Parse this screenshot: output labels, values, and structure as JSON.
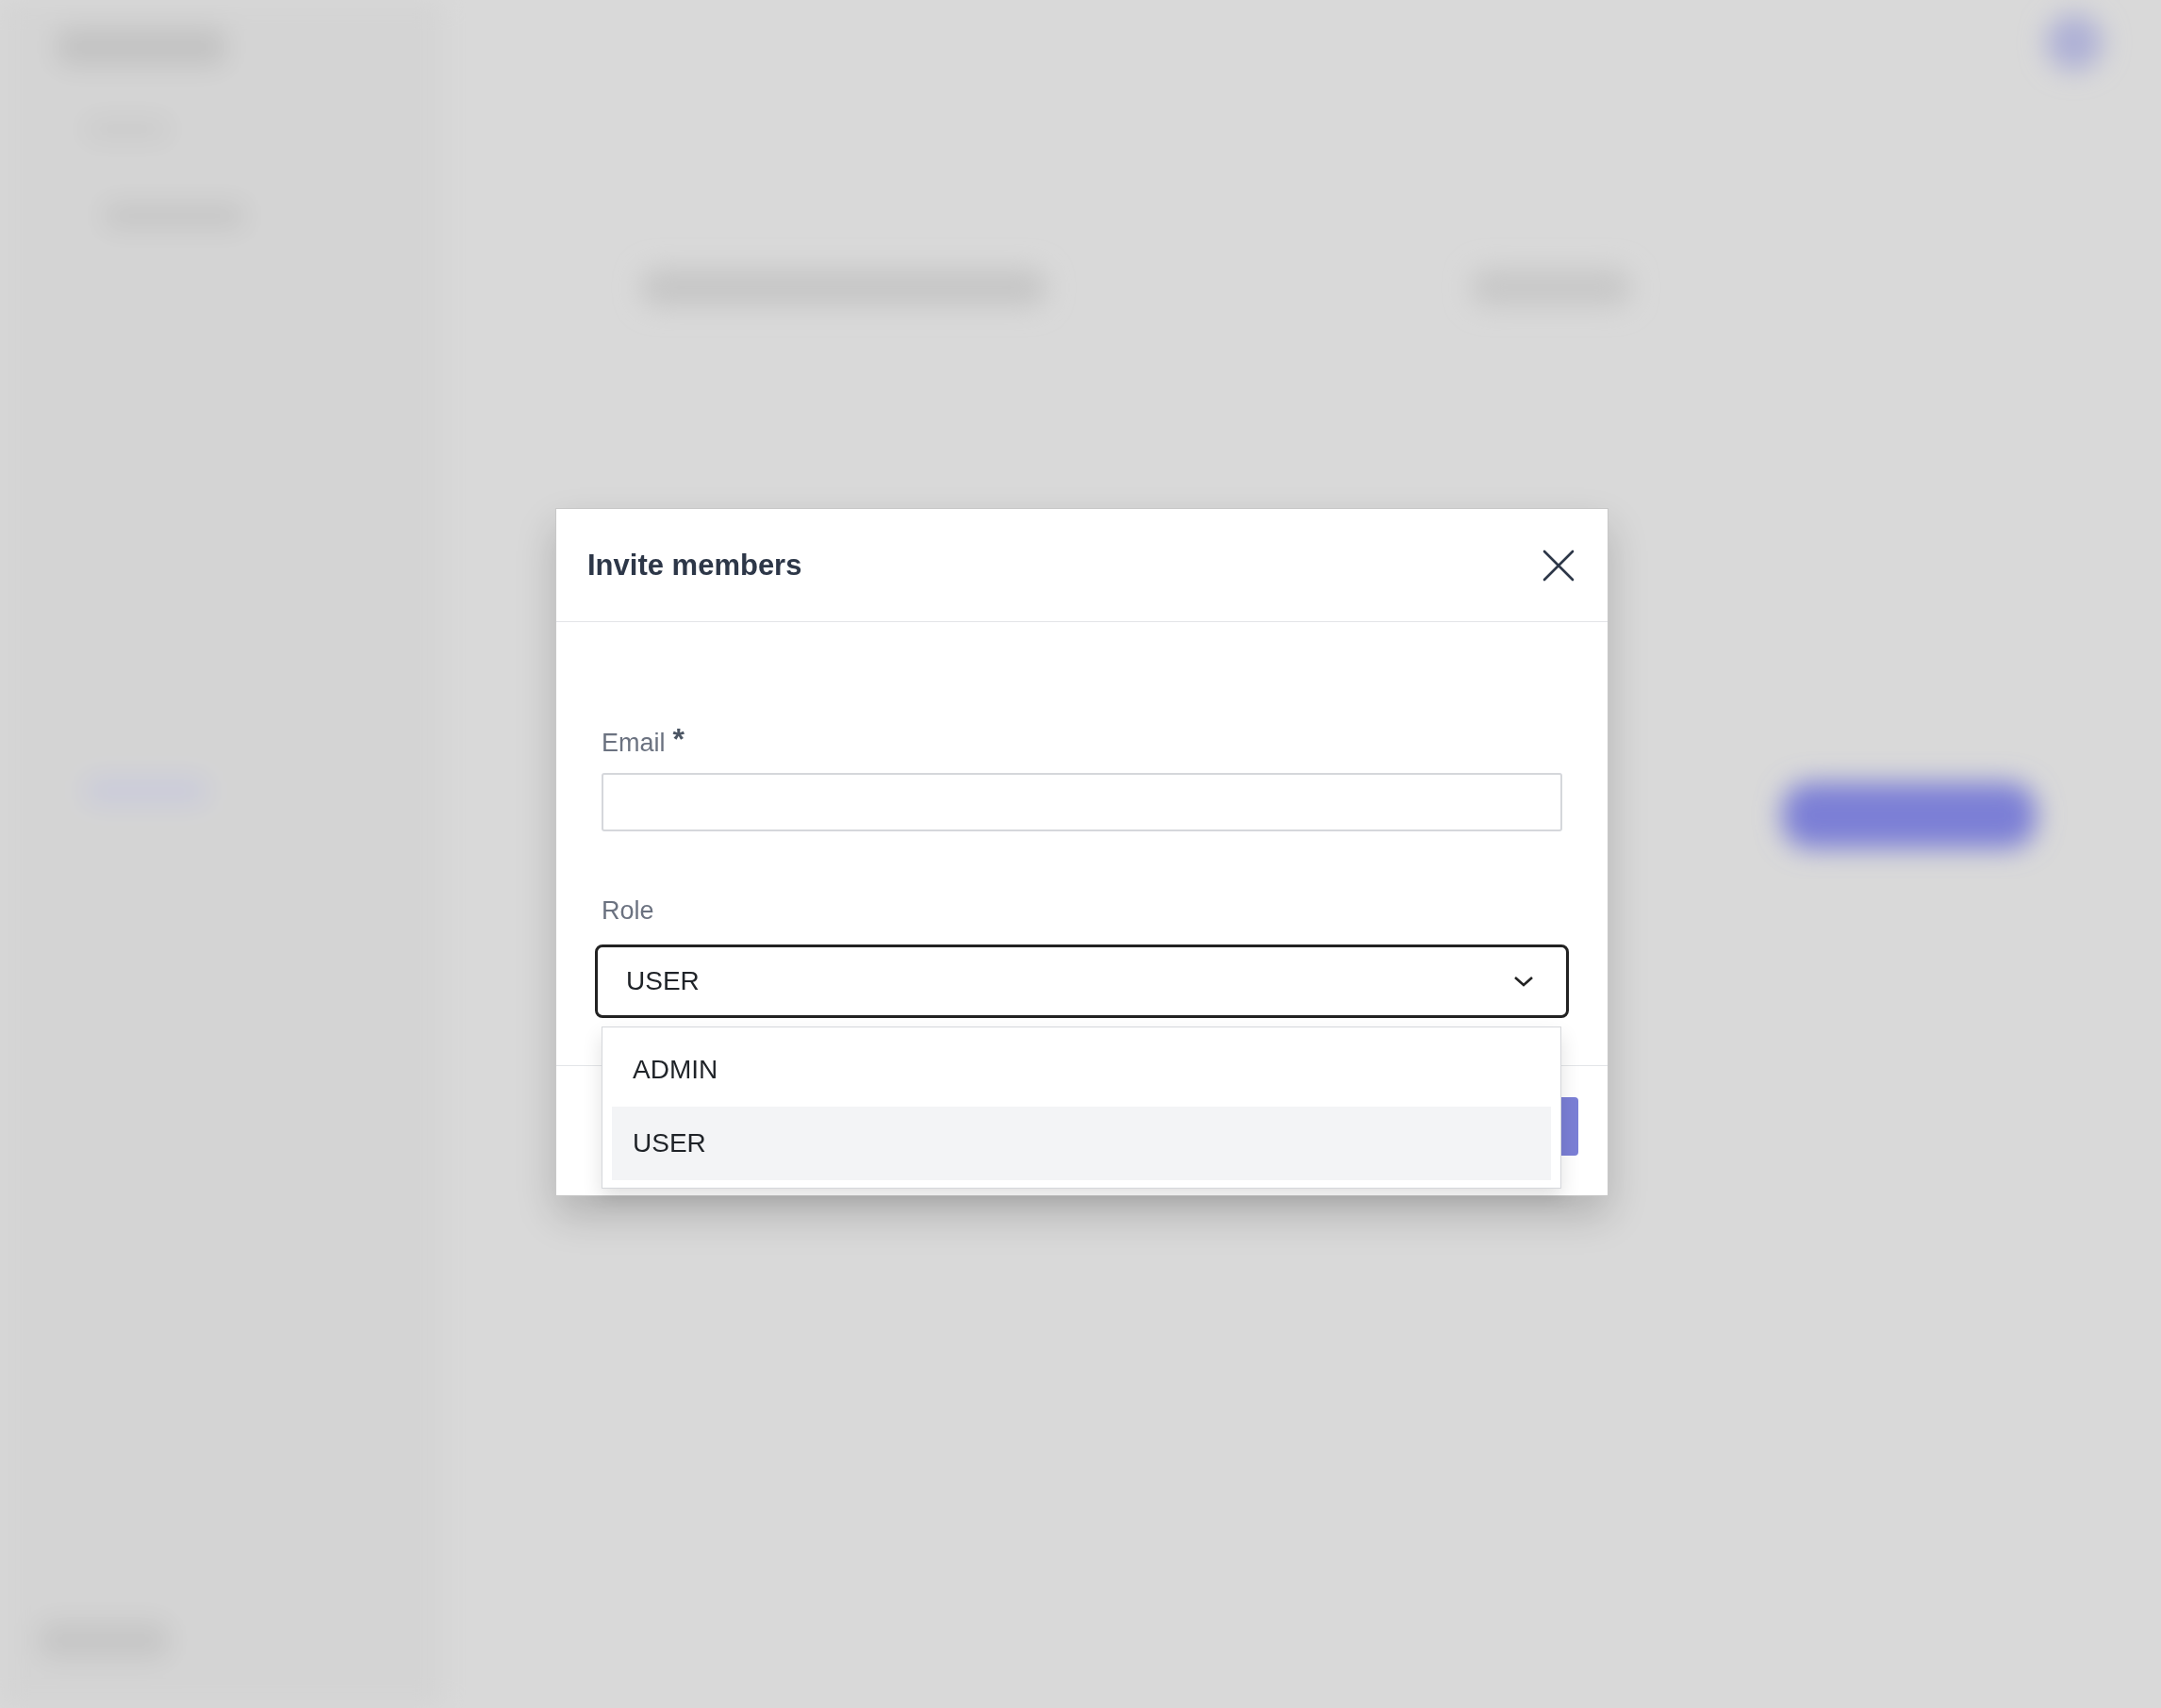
{
  "dialog": {
    "title": "Invite members",
    "fields": [
      {
        "kind": "text",
        "label": "Email",
        "required_mark": "*"
      },
      {
        "kind": "select",
        "label": "Role",
        "value": "USER",
        "expanded": true,
        "options": [
          {
            "label": "ADMIN",
            "selected": false
          },
          {
            "label": "USER",
            "selected": true
          }
        ]
      }
    ]
  }
}
